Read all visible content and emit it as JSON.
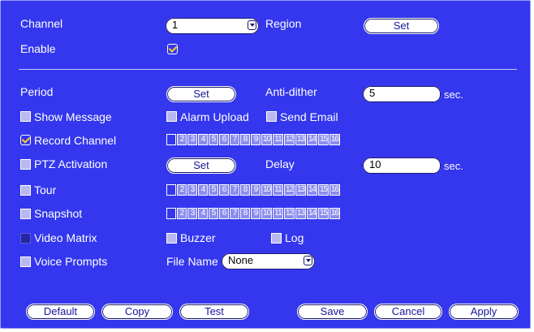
{
  "channel": {
    "label": "Channel",
    "value": "1"
  },
  "region": {
    "label": "Region",
    "button": "Set"
  },
  "enable": {
    "label": "Enable",
    "checked": true
  },
  "period": {
    "label": "Period",
    "button": "Set"
  },
  "anti_dither": {
    "label": "Anti-dither",
    "value": "5",
    "unit": "sec."
  },
  "show_message": {
    "label": "Show Message",
    "checked": false
  },
  "alarm_upload": {
    "label": "Alarm Upload",
    "checked": false
  },
  "send_email": {
    "label": "Send Email",
    "checked": false
  },
  "record_channel": {
    "label": "Record Channel",
    "checked": true
  },
  "ptz_activation": {
    "label": "PTZ Activation",
    "checked": false,
    "button": "Set"
  },
  "delay": {
    "label": "Delay",
    "value": "10",
    "unit": "sec."
  },
  "tour": {
    "label": "Tour",
    "checked": false
  },
  "snapshot": {
    "label": "Snapshot",
    "checked": false
  },
  "video_matrix": {
    "label": "Video Matrix",
    "checked": false
  },
  "buzzer": {
    "label": "Buzzer",
    "checked": false
  },
  "log": {
    "label": "Log",
    "checked": false
  },
  "voice_prompts": {
    "label": "Voice Prompts",
    "checked": false
  },
  "file_name": {
    "label": "File Name",
    "value": "None"
  },
  "channel_numbers": [
    "1",
    "2",
    "3",
    "4",
    "5",
    "6",
    "7",
    "8",
    "9",
    "10",
    "11",
    "12",
    "13",
    "14",
    "15",
    "16"
  ],
  "footer": {
    "default": "Default",
    "copy": "Copy",
    "test": "Test",
    "save": "Save",
    "cancel": "Cancel",
    "apply": "Apply"
  },
  "colors": {
    "background": "#3437ee",
    "text": "#ffffff",
    "button_text": "#16169a",
    "checkmark": "#ffd21e"
  }
}
